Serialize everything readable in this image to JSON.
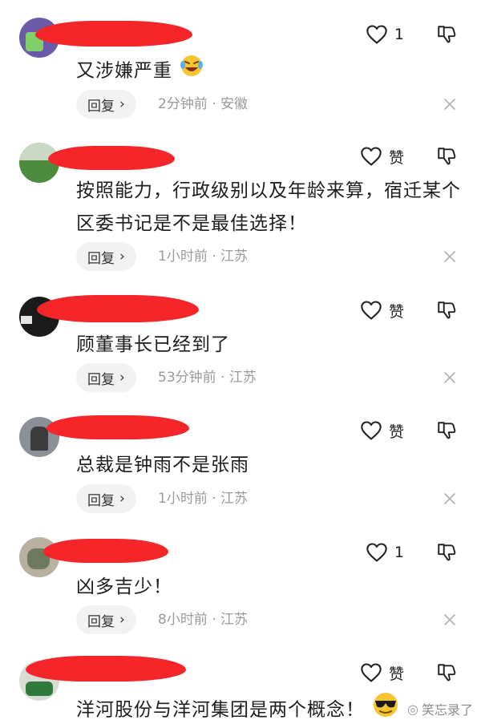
{
  "ui": {
    "reply_label": "回复",
    "reply_chevron": "›",
    "colors": {
      "redaction": "#f4262a",
      "meta": "#9a9a9a",
      "reply_bg": "#f2f2f2"
    },
    "icons": {
      "like": "heart-outline-icon",
      "dislike": "thumbs-down-icon",
      "close": "close-icon"
    }
  },
  "comments": [
    {
      "like_text": "1",
      "content": "又涉嫌严重",
      "meta": "2分钟前 · 安徽",
      "emoji": "laughing-crying-emoji"
    },
    {
      "like_text": "赞",
      "content": "按照能力，行政级别以及年龄来算，宿迁某个区委书记是不是最佳选择！",
      "meta": "1小时前 · 江苏"
    },
    {
      "like_text": "赞",
      "content": "顾董事长已经到了",
      "meta": "53分钟前 · 江苏"
    },
    {
      "like_text": "赞",
      "content": "总裁是钟雨不是张雨",
      "meta": "1小时前 · 江苏"
    },
    {
      "like_text": "1",
      "content": "凶多吉少！",
      "meta": "8小时前 · 江苏"
    },
    {
      "like_text": "赞",
      "content": "洋河股份与洋河集团是两个概念！",
      "emoji": "sunglasses-emoji"
    }
  ],
  "watermark": {
    "text": "笑忘录了"
  }
}
